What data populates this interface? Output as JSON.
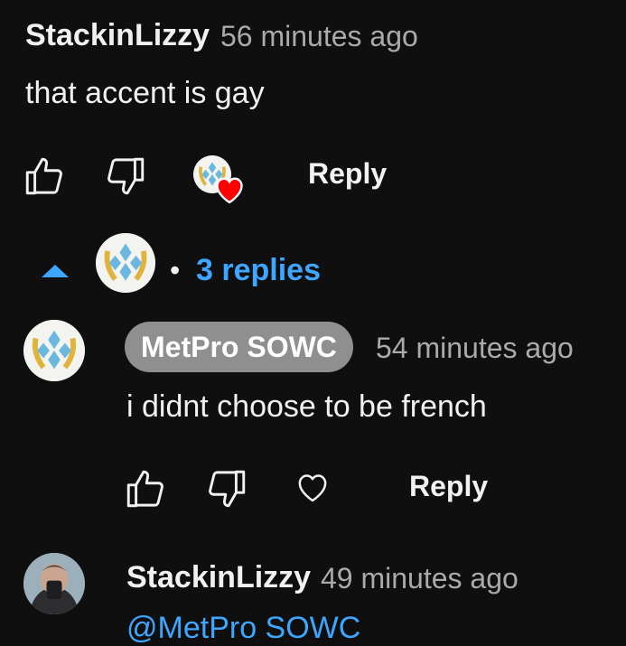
{
  "comment": {
    "author": "StackinLizzy",
    "time": "56 minutes ago",
    "text": "that accent is gay",
    "reply_label": "Reply",
    "replies_toggle": {
      "dot": "•",
      "label": "3 replies"
    }
  },
  "replies": [
    {
      "author": "MetPro SOWC",
      "time": "54 minutes ago",
      "text": "i didnt choose to be french",
      "reply_label": "Reply"
    },
    {
      "author": "StackinLizzy",
      "time": "49 minutes ago",
      "text_partial": "@MetPro SOWC"
    }
  ],
  "colors": {
    "background": "#0f0f0f",
    "link_blue": "#3ea6ff",
    "heart_red": "#ff0000",
    "owner_pill": "#8f8f8f"
  }
}
